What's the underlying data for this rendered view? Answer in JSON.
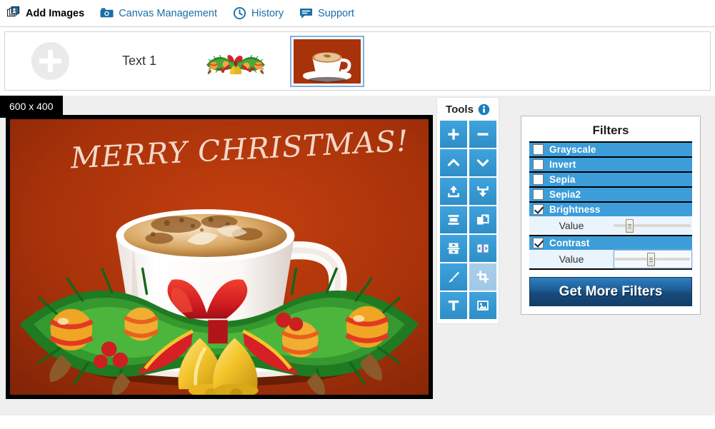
{
  "menu": {
    "items": [
      {
        "label": "Add Images",
        "icon": "stacked-images-icon",
        "primary": true
      },
      {
        "label": "Canvas Management",
        "icon": "camera-icon",
        "primary": false
      },
      {
        "label": "History",
        "icon": "clock-icon",
        "primary": false
      },
      {
        "label": "Support",
        "icon": "speech-bubble-icon",
        "primary": false
      }
    ]
  },
  "strip": {
    "add_label": "+",
    "text_layer_label": "Text 1",
    "garland_alt": "christmas-garland-thumbnail",
    "cup_alt": "coffee-cup-thumbnail-selected"
  },
  "canvas": {
    "size_badge": "600 x 400",
    "artwork_text": "MERRY CHRISTMAS!",
    "background_color": "#a8320a",
    "border_color": "#000000"
  },
  "tools": {
    "title": "Tools",
    "info_icon": "info-icon",
    "buttons": [
      {
        "name": "zoom-in",
        "icon": "plus-icon"
      },
      {
        "name": "zoom-out",
        "icon": "minus-icon"
      },
      {
        "name": "move-up",
        "icon": "chevron-up-icon"
      },
      {
        "name": "move-down",
        "icon": "chevron-down-icon"
      },
      {
        "name": "bring-to-front",
        "icon": "upload-arrow-icon"
      },
      {
        "name": "send-to-back",
        "icon": "download-arrow-icon"
      },
      {
        "name": "align-center",
        "icon": "align-icon"
      },
      {
        "name": "duplicate",
        "icon": "duplicate-icon"
      },
      {
        "name": "flip-vertical",
        "icon": "flip-vertical-icon"
      },
      {
        "name": "flip-horizontal",
        "icon": "flip-horizontal-icon"
      },
      {
        "name": "brush",
        "icon": "brush-icon"
      },
      {
        "name": "crop",
        "icon": "crop-icon",
        "active": true
      },
      {
        "name": "add-text",
        "icon": "text-icon"
      },
      {
        "name": "add-image",
        "icon": "image-icon"
      }
    ]
  },
  "filters": {
    "title": "Filters",
    "rows": [
      {
        "label": "Grayscale",
        "checked": false,
        "has_value": false
      },
      {
        "label": "Invert",
        "checked": false,
        "has_value": false
      },
      {
        "label": "Sepia",
        "checked": false,
        "has_value": false
      },
      {
        "label": "Sepia2",
        "checked": false,
        "has_value": false
      },
      {
        "label": "Brightness",
        "checked": true,
        "has_value": true,
        "value_label": "Value",
        "value_percent": 18,
        "focused": false
      },
      {
        "label": "Contrast",
        "checked": true,
        "has_value": true,
        "value_label": "Value",
        "value_percent": 48,
        "focused": true
      }
    ],
    "get_more_label": "Get More Filters",
    "row_color": "#3c9dd9",
    "value_row_color": "#eaf4fd"
  }
}
